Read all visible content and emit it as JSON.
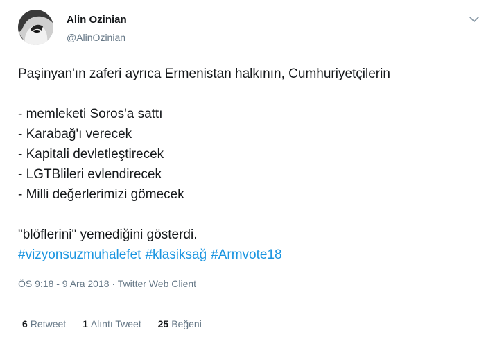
{
  "author": {
    "name": "Alin Ozinian",
    "handle": "@AlinOzinian"
  },
  "icons": {
    "menu": "chevron-down-icon",
    "avatar": "profile-photo"
  },
  "tweet": {
    "lines": [
      "Paşinyan'ın zaferi ayrıca Ermenistan halkının, Cumhuriyetçilerin",
      "",
      "- memleketi Soros'a sattı",
      "- Karabağ'ı verecek",
      "- Kapitali devletleştirecek",
      "- LGTBlileri evlendirecek",
      "- Milli değerlerimizi gömecek",
      "",
      "\"blöflerini\" yemediğini gösterdi."
    ],
    "hashtags": [
      "#vizyonsuzmuhalefet",
      "#klasiksağ",
      "#Armvote18"
    ]
  },
  "meta": {
    "time_date_client": "ÖS 9:18 - 9 Ara 2018 · Twitter Web Client"
  },
  "stats": {
    "retweet_count": "6",
    "retweet_label": "Retweet",
    "quote_count": "1",
    "quote_label": "Alıntı Tweet",
    "like_count": "25",
    "like_label": "Beğeni"
  },
  "colors": {
    "hashtag": "#1b95e0",
    "secondary_text": "#657786",
    "primary_text": "#14171a"
  }
}
